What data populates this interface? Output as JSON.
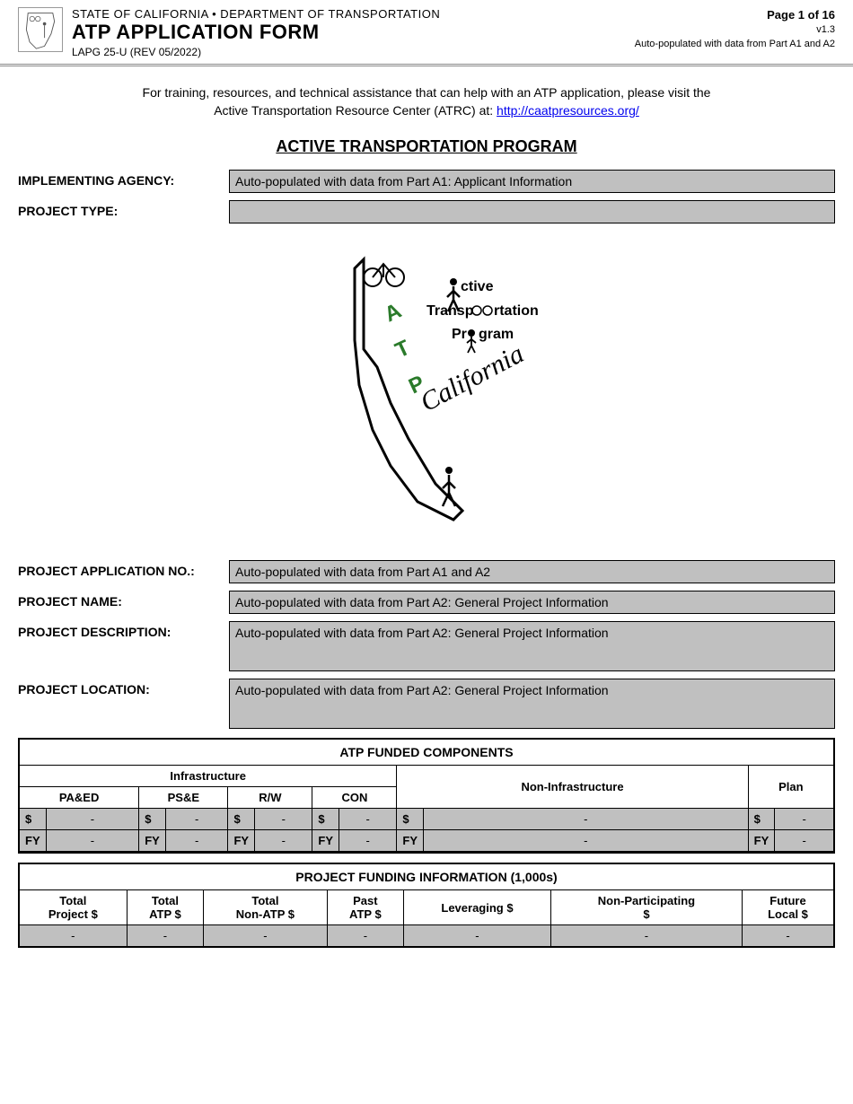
{
  "header": {
    "department": "STATE OF CALIFORNIA • DEPARTMENT OF TRANSPORTATION",
    "formTitle": "ATP APPLICATION FORM",
    "formCode": "LAPG 25-U (REV 05/2022)",
    "page": "Page 1 of 16",
    "version": "v1.3",
    "autoNote": "Auto-populated with data from Part A1 and A2"
  },
  "intro": {
    "text1": "For training, resources, and technical assistance that can help with an ATP application, please visit the",
    "text2": "Active Transportation Resource Center (ATRC) at: ",
    "linkText": "http://caatpresources.org/",
    "linkUrl": "http://caatpresources.org/"
  },
  "programTitle": "ACTIVE TRANSPORTATION PROGRAM",
  "fields": {
    "implementingAgency": {
      "label": "IMPLEMENTING AGENCY:",
      "value": "Auto-populated with data from Part A1: Applicant Information"
    },
    "projectType": {
      "label": "PROJECT TYPE:",
      "value": ""
    },
    "projectAppNo": {
      "label": "PROJECT APPLICATION NO.:",
      "value": "Auto-populated with data from Part A1 and A2"
    },
    "projectName": {
      "label": "PROJECT NAME:",
      "value": "Auto-populated with data from Part A2: General Project Information"
    },
    "projectDescription": {
      "label": "PROJECT DESCRIPTION:",
      "value": "Auto-populated with data from Part A2: General Project Information"
    },
    "projectLocation": {
      "label": "PROJECT LOCATION:",
      "value": "Auto-populated with data from Part A2: General Project Information"
    }
  },
  "atpTable": {
    "title": "ATP FUNDED COMPONENTS",
    "infraHeader": "Infrastructure",
    "cols": [
      "PA&ED",
      "PS&E",
      "R/W",
      "CON",
      "Non-Infrastructure",
      "Plan"
    ],
    "rowLabels": [
      "$",
      "FY"
    ],
    "rows": [
      [
        "-",
        "-",
        "-",
        "-",
        "-",
        "-"
      ],
      [
        "-",
        "-",
        "-",
        "-",
        "-",
        "-"
      ]
    ]
  },
  "fundingTable": {
    "title": "PROJECT FUNDING INFORMATION (1,000s)",
    "cols": [
      "Total\nProject $",
      "Total\nATP $",
      "Total\nNon-ATP $",
      "Past\nATP $",
      "Leveraging $",
      "Non-Participating\n$",
      "Future\nLocal $"
    ],
    "row": [
      "-",
      "-",
      "-",
      "-",
      "-",
      "-",
      "-"
    ]
  }
}
